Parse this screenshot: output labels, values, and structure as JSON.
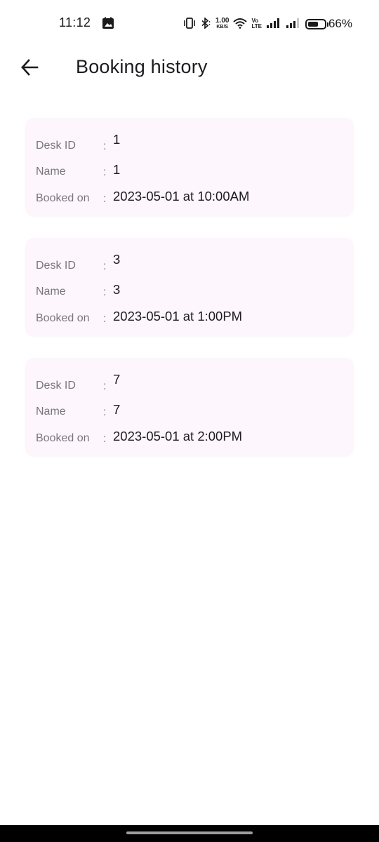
{
  "status_bar": {
    "time": "11:12",
    "network_speed_value": "1.00",
    "network_speed_unit": "KB/S",
    "volte_top": "Vo",
    "volte_bottom": "LTE",
    "battery_percent": "66%",
    "battery_level": 0.66,
    "icons": [
      "gallery-icon",
      "vibrate-icon",
      "bluetooth-icon",
      "wifi-icon",
      "signal-icon",
      "signal-icon-2",
      "battery-icon"
    ]
  },
  "app_bar": {
    "title": "Booking history",
    "back_icon": "arrow-left-icon"
  },
  "bookings": [
    {
      "desk_id_label": "Desk ID",
      "desk_id": "1",
      "name_label": "Name",
      "name": "1",
      "booked_on_label": "Booked on",
      "booked_on": "2023-05-01 at 10:00AM"
    },
    {
      "desk_id_label": "Desk ID",
      "desk_id": "3",
      "name_label": "Name",
      "name": "3",
      "booked_on_label": "Booked on",
      "booked_on": "2023-05-01 at 1:00PM"
    },
    {
      "desk_id_label": "Desk ID",
      "desk_id": "7",
      "name_label": "Name",
      "name": "7",
      "booked_on_label": "Booked on",
      "booked_on": "2023-05-01 at 2:00PM"
    }
  ],
  "separator": ":",
  "colors": {
    "card_background": "#fdf6fd",
    "label": "#7a757d",
    "value": "#1c1b1f"
  }
}
